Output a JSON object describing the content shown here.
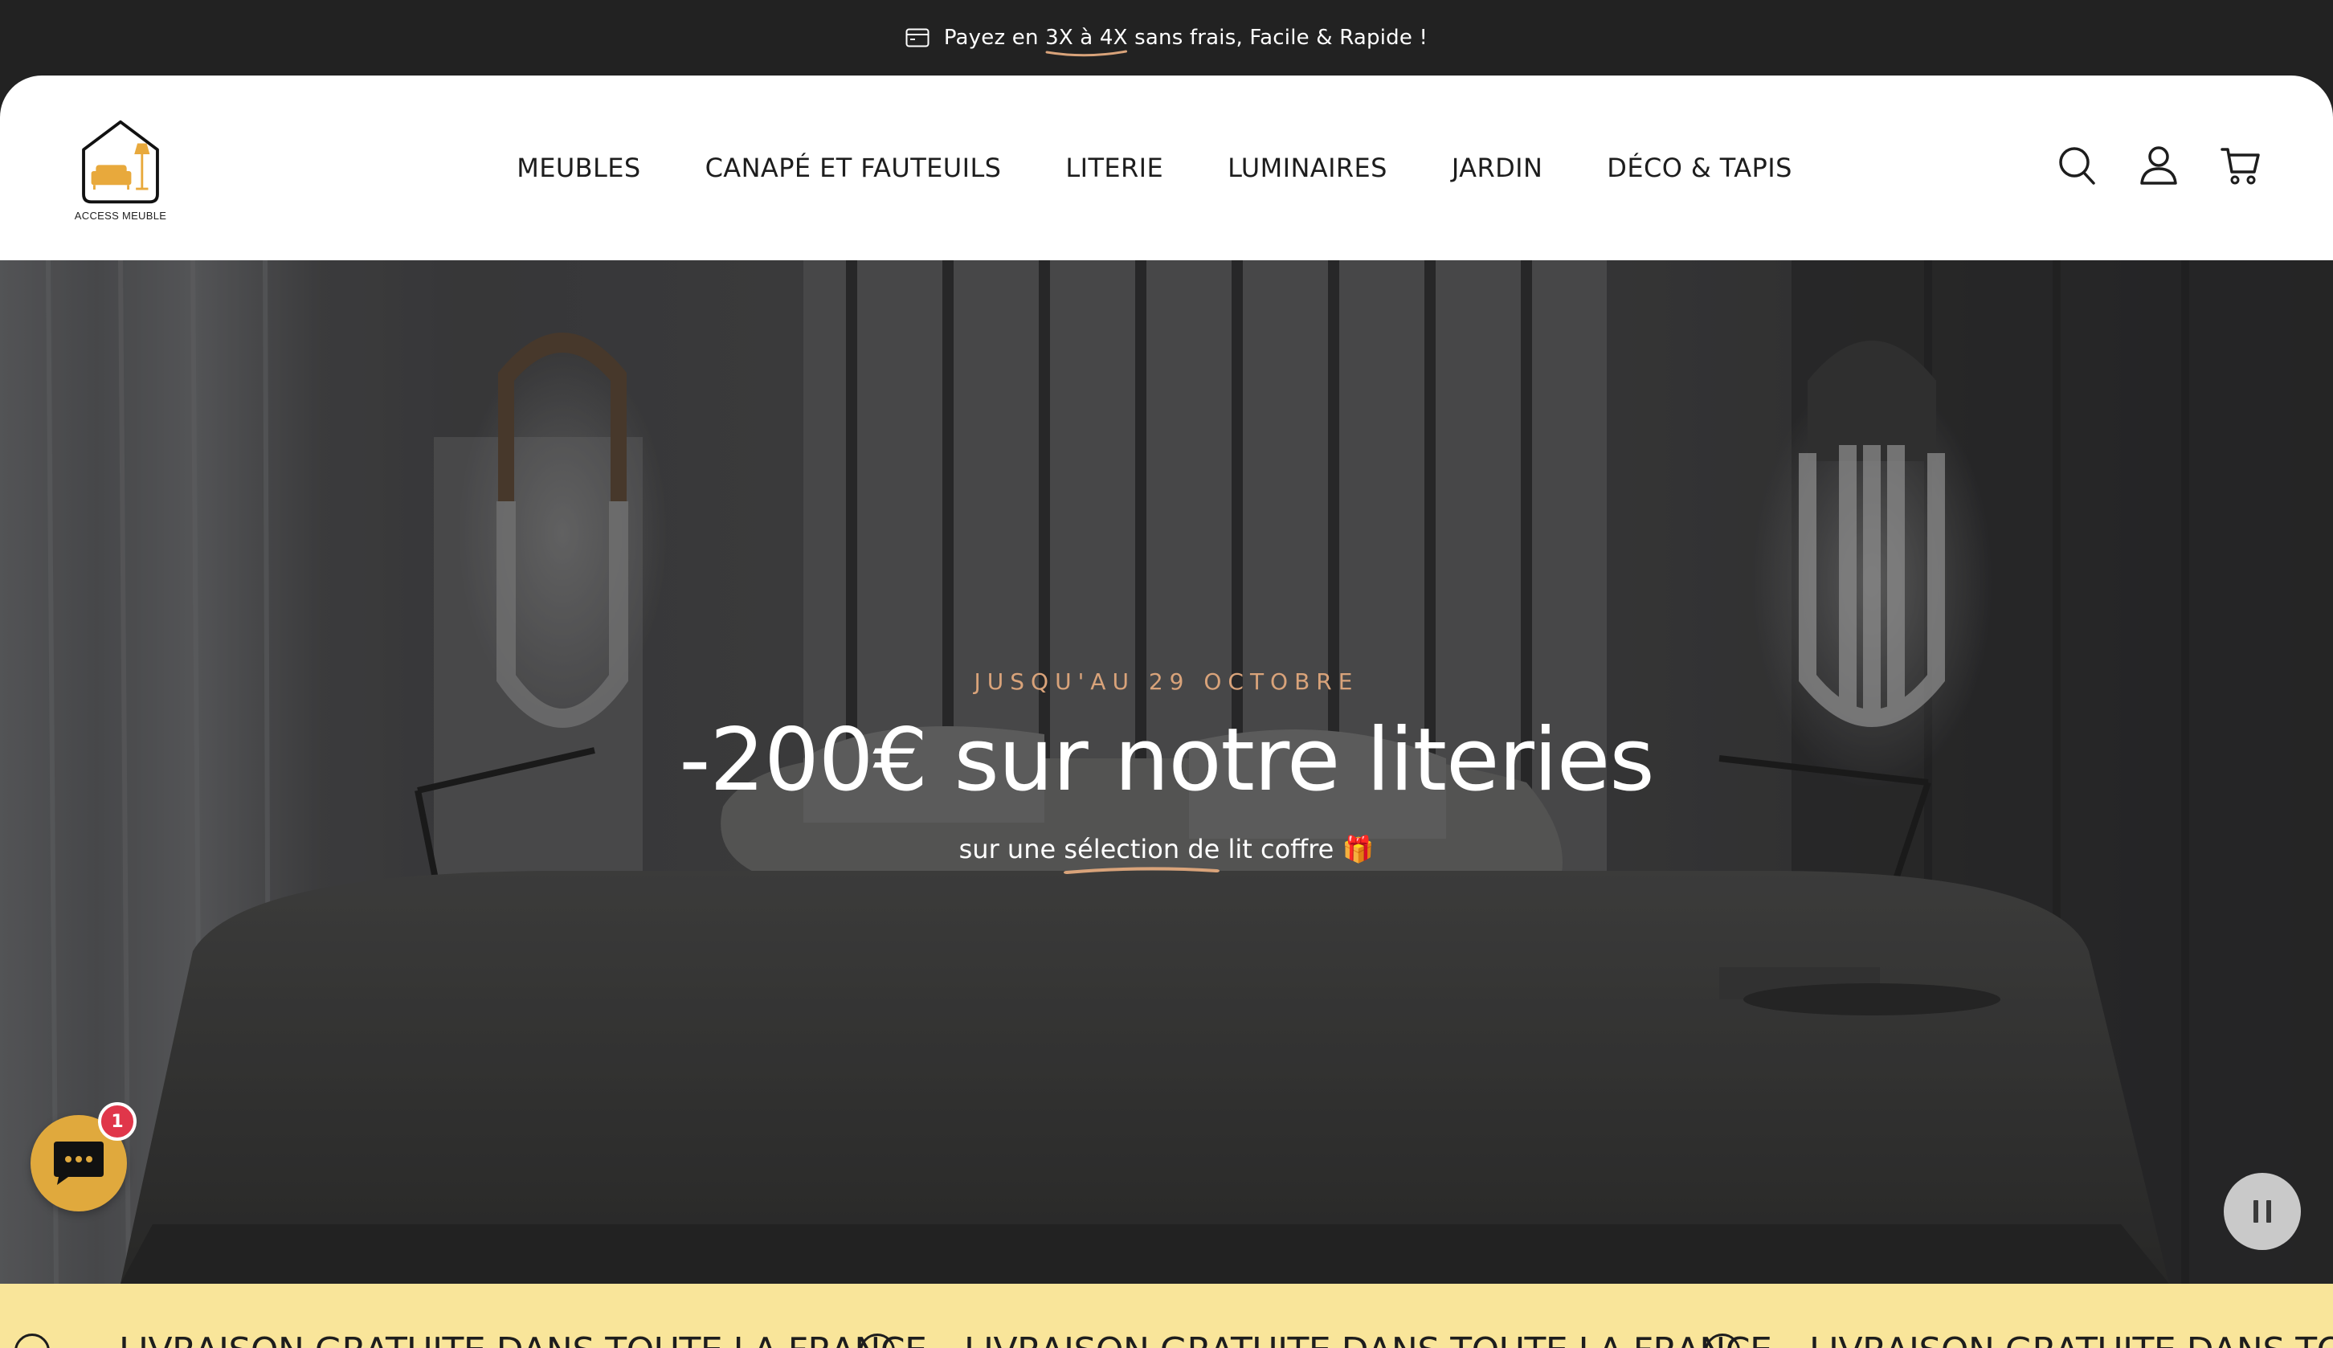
{
  "announcement": {
    "prefix": "Payez en ",
    "highlight": "3X à 4X",
    "suffix": " sans frais, Facile & Rapide !"
  },
  "header": {
    "logo_text": "ACCESS MEUBLE",
    "nav": [
      {
        "label": "MEUBLES"
      },
      {
        "label": "CANAPÉ ET FAUTEUILS"
      },
      {
        "label": "LITERIE"
      },
      {
        "label": "LUMINAIRES"
      },
      {
        "label": "JARDIN"
      },
      {
        "label": "DÉCO & TAPIS"
      }
    ],
    "icons": [
      "search-icon",
      "account-icon",
      "cart-icon"
    ]
  },
  "hero": {
    "eyebrow": "JUSQU'AU 29 OCTOBRE",
    "headline": "-200€ sur notre literies",
    "subline_before": "sur une ",
    "subline_highlight": "sélection de",
    "subline_after": " lit coffre 🎁"
  },
  "chat": {
    "badge_count": "1"
  },
  "marquee": {
    "items": [
      "LIVRAISON GRATUITE DANS TOUTE LA FRANCE",
      "LIVRAISON GRATUITE DANS TOUTE LA FRANCE",
      "LIVRAISON GRATUITE DANS TOUTE LA FRANCE"
    ]
  },
  "colors": {
    "announcement_bg": "#222222",
    "accent_orange": "#d9a37a",
    "logo_yellow": "#e8a93c",
    "chat_bg": "#e0a93d",
    "badge_red": "#e0364a",
    "marquee_bg": "#f9e59a"
  }
}
